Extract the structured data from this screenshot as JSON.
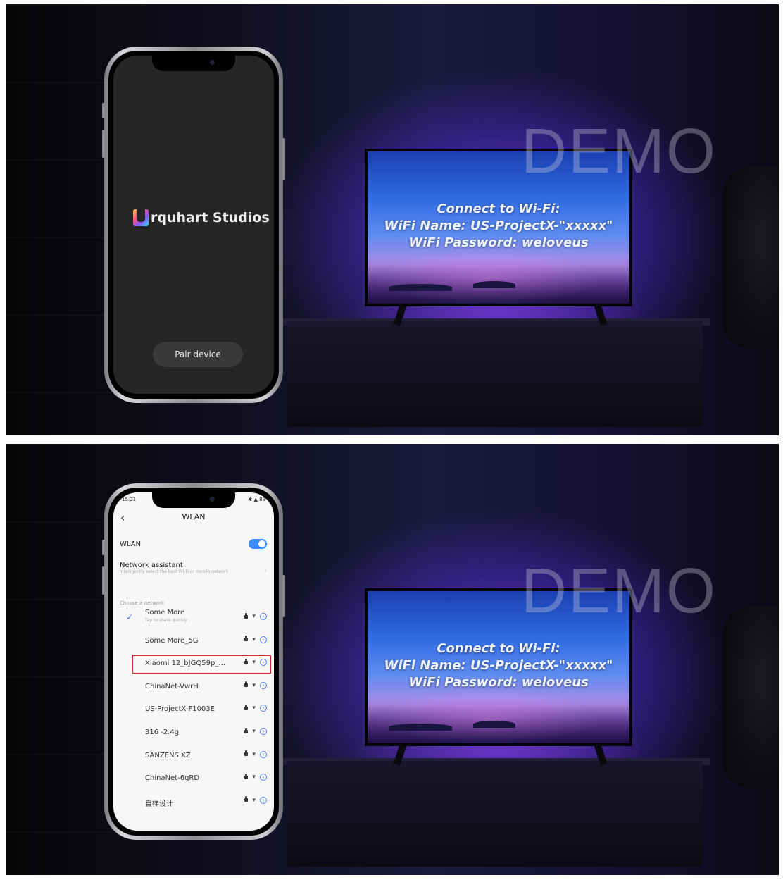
{
  "watermark": "DEMO",
  "tv": {
    "line1": "Connect to Wi-Fi:",
    "line2": "WiFi Name: US-ProjectX-\"xxxxx\"",
    "line3": "WiFi Password: weloveus"
  },
  "app": {
    "brand_text": "rquhart Studios",
    "pair_button": "Pair device"
  },
  "wlan": {
    "status_time": "15:21",
    "status_icons": "✱ ▲ 89",
    "back": "‹",
    "title": "WLAN",
    "wlan_label": "WLAN",
    "wlan_on": true,
    "assistant_title": "Network assistant",
    "assistant_sub": "Intelligently select the best Wi-Fi or mobile network",
    "section_label": "Choose a network",
    "networks": [
      {
        "name": "Some More",
        "hint": "Tap to share quickly",
        "connected": true
      },
      {
        "name": "Some More_5G",
        "hint": "",
        "connected": false
      },
      {
        "name": "Xiaomi 12_bJGQ59p_…",
        "hint": "",
        "connected": false,
        "highlighted": true
      },
      {
        "name": "ChinaNet-VwrH",
        "hint": "",
        "connected": false
      },
      {
        "name": "US-ProjectX-F1003E",
        "hint": "",
        "connected": false
      },
      {
        "name": "316 -2.4g",
        "hint": "",
        "connected": false
      },
      {
        "name": "SANZENS.XZ",
        "hint": "",
        "connected": false
      },
      {
        "name": "ChinaNet-6qRD",
        "hint": "",
        "connected": false
      },
      {
        "name": "自样设计",
        "hint": "",
        "connected": false
      }
    ],
    "icons": [
      "lock-icon",
      "wifi-icon",
      "info-icon"
    ]
  },
  "colors": {
    "accent_blue": "#3b8bff",
    "highlight_red": "#e22222"
  }
}
